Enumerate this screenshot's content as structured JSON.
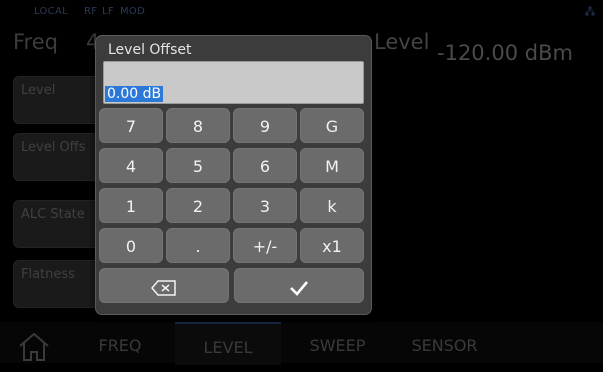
{
  "status": {
    "indicators": [
      "LOCAL",
      "RF",
      "LF",
      "MOD"
    ]
  },
  "header": {
    "freq_label": "Freq",
    "freq_value": "4",
    "level_label": "Level",
    "level_value": "-120.00 dBm"
  },
  "sidebar": {
    "items": [
      {
        "label": "Level"
      },
      {
        "label": "Level Offs"
      },
      {
        "label": "ALC State"
      },
      {
        "label": "Flatness"
      }
    ]
  },
  "dialog": {
    "title": "Level Offset",
    "value": "0.00 dB",
    "keys": [
      [
        "7",
        "8",
        "9",
        "G"
      ],
      [
        "4",
        "5",
        "6",
        "M"
      ],
      [
        "1",
        "2",
        "3",
        "k"
      ],
      [
        "0",
        ".",
        "+/-",
        "x1"
      ]
    ],
    "backspace_icon": "backspace-icon",
    "confirm_icon": "checkmark-icon"
  },
  "bottom_nav": {
    "home_icon": "home-icon",
    "tabs": [
      {
        "label": "FREQ"
      },
      {
        "label": "LEVEL"
      },
      {
        "label": "SWEEP"
      },
      {
        "label": "SENSOR"
      }
    ],
    "active_tab": "LEVEL"
  },
  "colors": {
    "background": "#000000",
    "dialog_bg": "#3c3c3c",
    "key_bg": "#6b6b6b",
    "selection": "#2b78d8",
    "field_bg": "#c9c9c9"
  }
}
